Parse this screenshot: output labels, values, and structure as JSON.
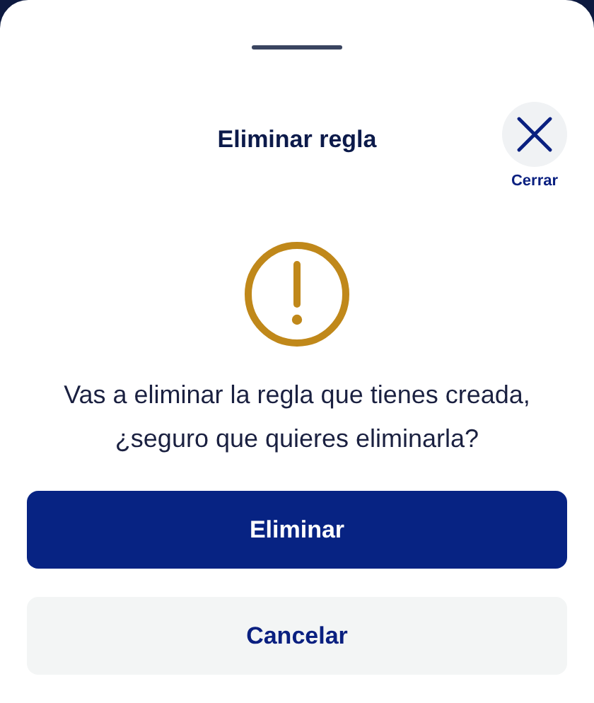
{
  "dialog": {
    "title": "Eliminar regla",
    "close_label": "Cerrar",
    "message": "Vas a eliminar la regla que tienes creada, ¿seguro que quieres eliminarla?"
  },
  "buttons": [
    {
      "label": "Eliminar",
      "kind": "primary"
    },
    {
      "label": "Cancelar",
      "kind": "secondary"
    }
  ]
}
